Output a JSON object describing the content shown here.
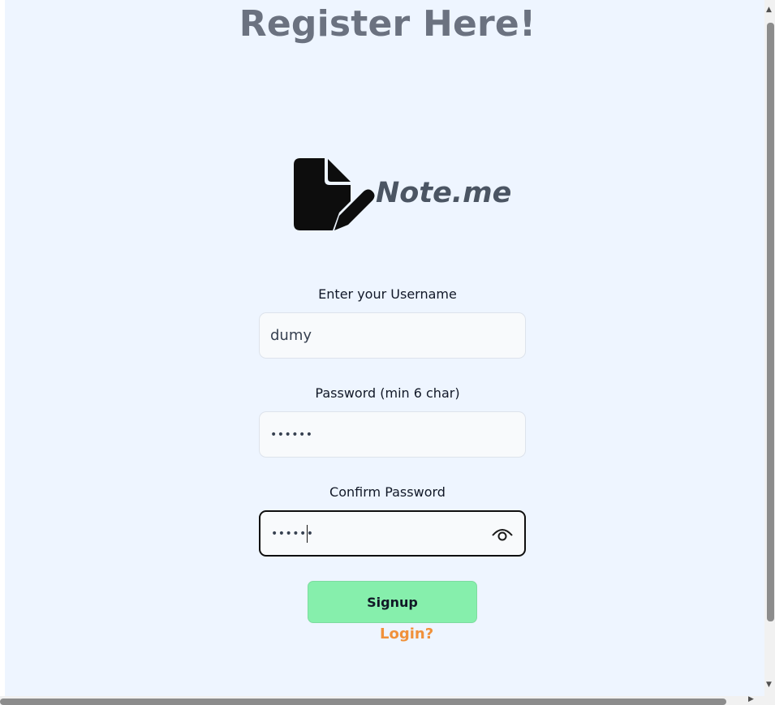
{
  "page": {
    "title": "Register Here!"
  },
  "logo": {
    "icon": "file-pen-icon",
    "text": "Note.me"
  },
  "form": {
    "username": {
      "label": "Enter your Username",
      "value": "dumy"
    },
    "password": {
      "label": "Password (min 6 char)",
      "value": "••••••"
    },
    "confirm_password": {
      "label": "Confirm Password",
      "value": "••••••",
      "toggle_icon": "eye-icon"
    },
    "signup_label": "Signup",
    "login_label": "Login?"
  },
  "colors": {
    "background": "#eef5ff",
    "title": "#6b7280",
    "signup_button": "#86efac",
    "login_link": "#f0913a"
  }
}
